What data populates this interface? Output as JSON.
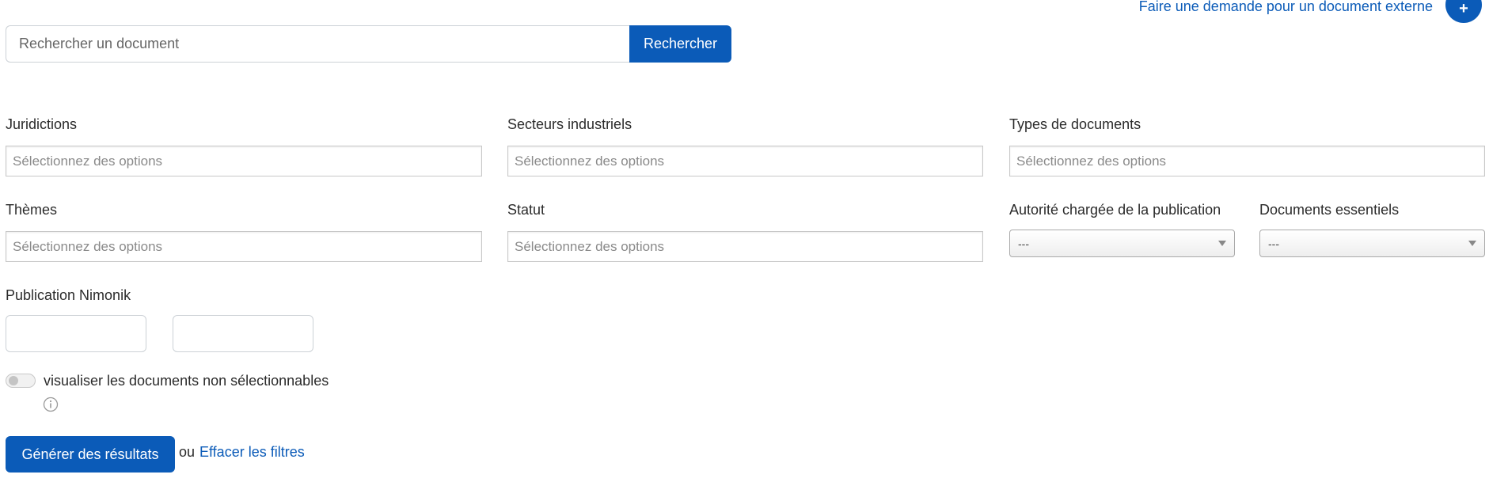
{
  "header": {
    "external_request_label": "Faire une demande pour un document externe",
    "plus_symbol": "+"
  },
  "search": {
    "placeholder": "Rechercher un document",
    "value": "",
    "button_label": "Rechercher"
  },
  "filters": {
    "jurisdictions": {
      "label": "Juridictions",
      "placeholder": "Sélectionnez des options"
    },
    "industrial_sectors": {
      "label": "Secteurs industriels",
      "placeholder": "Sélectionnez des options"
    },
    "document_types": {
      "label": "Types de documents",
      "placeholder": "Sélectionnez des options"
    },
    "themes": {
      "label": "Thèmes",
      "placeholder": "Sélectionnez des options"
    },
    "status": {
      "label": "Statut",
      "placeholder": "Sélectionnez des options"
    },
    "publishing_authority": {
      "label": "Autorité chargée de la publication",
      "selected": "---"
    },
    "essential_documents": {
      "label": "Documents essentiels",
      "selected": "---"
    },
    "nimonik_publication": {
      "label": "Publication Nimonik",
      "from_value": "",
      "to_value": ""
    }
  },
  "toggle": {
    "label": "visualiser les documents non sélectionnables",
    "checked": false
  },
  "actions": {
    "generate_label": "Générer des résultats",
    "or_text": "ou",
    "clear_label": "Effacer les filtres"
  },
  "colors": {
    "accent": "#0b5bb8",
    "text": "#2b2b2b",
    "placeholder": "#8a8a8a"
  }
}
